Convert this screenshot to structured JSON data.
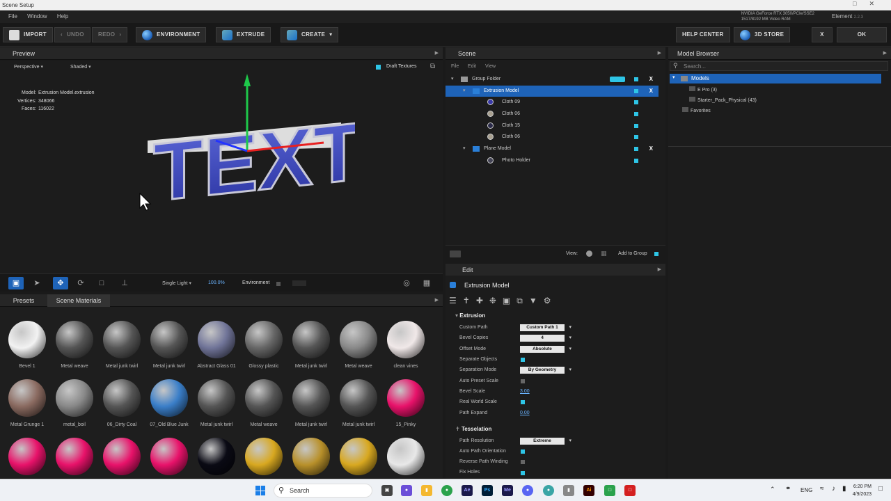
{
  "window": {
    "title": "Scene Setup"
  },
  "menu": [
    "File",
    "Window",
    "Help"
  ],
  "gpu": {
    "name": "NVIDIA GeForce RTX 3050/PCIe/SSE2",
    "vram": "1517/8192 MB Video RAM"
  },
  "element": {
    "name": "Element",
    "version": "2.2.3"
  },
  "toolbar": {
    "import": "IMPORT",
    "undo": "UNDO",
    "redo": "REDO",
    "environment": "ENVIRONMENT",
    "extrude": "EXTRUDE",
    "create": "CREATE",
    "help": "HELP CENTER",
    "store": "3D STORE",
    "close": "X",
    "ok": "OK"
  },
  "preview": {
    "title": "Preview",
    "camera": "Perspective",
    "shading": "Shaded",
    "draft": "Draft Textures",
    "model_label": "Model:",
    "model": "Extrusion Model.extrusion",
    "vertices_label": "Vertices:",
    "vertices": "348066",
    "faces_label": "Faces:",
    "faces": "116022",
    "light": "Single Light",
    "light_pct": "100.0%",
    "environment": "Environment",
    "text3d": "TEXT"
  },
  "scene": {
    "title": "Scene",
    "menu": [
      "File",
      "Edit",
      "View"
    ],
    "tree": [
      {
        "label": "Group Folder",
        "level": 0
      },
      {
        "label": "Extrusion Model",
        "level": 1,
        "selected": true
      },
      {
        "label": "Cloth 09",
        "level": 2,
        "color": "#3a3aa8"
      },
      {
        "label": "Cloth 06",
        "level": 2,
        "color": "#a8a090"
      },
      {
        "label": "Cloth 15",
        "level": 2,
        "color": "#2a2a48"
      },
      {
        "label": "Cloth 06",
        "level": 2,
        "color": "#a8a090"
      },
      {
        "label": "Plane Model",
        "level": 1
      },
      {
        "label": "Photo Holder",
        "level": 2,
        "color": "#445"
      }
    ],
    "view_label": "View:",
    "add_group": "Add to Group"
  },
  "edit": {
    "title": "Edit",
    "object": "Extrusion Model",
    "sec_extrusion": "Extrusion",
    "sec_tess": "Tesselation",
    "custom_path": "Custom Path",
    "custom_path_val": "Custom Path 1",
    "bevel_copies": "Bevel Copies",
    "bevel_copies_val": "4",
    "offset_mode": "Offset Mode",
    "offset_mode_val": "Absolute",
    "separate": "Separate Objects",
    "sep_mode": "Separation Mode",
    "sep_mode_val": "By Geometry",
    "auto_preset": "Auto Preset Scale",
    "bevel_scale": "Bevel Scale",
    "bevel_scale_val": "3.00",
    "real_world": "Real World Scale",
    "path_expand": "Path Expand",
    "path_expand_val": "0.00",
    "path_res": "Path Resolution",
    "path_res_val": "Extreme",
    "auto_orient": "Auto Path Orientation",
    "reverse": "Reverse Path Winding",
    "fix_holes": "Fix Holes"
  },
  "browser": {
    "title": "Model Browser",
    "search_placeholder": "Search...",
    "models": "Models",
    "epro": "E Pro (3)",
    "starter": "Starter_Pack_Physical (43)",
    "favorites": "Favorites"
  },
  "materials": {
    "tab_presets": "Presets",
    "tab_scene": "Scene Materials",
    "items": [
      {
        "name": "Bevel 1",
        "c": "#f2f2f2"
      },
      {
        "name": "Metal weave",
        "c": "#555"
      },
      {
        "name": "Metal junk twirl",
        "c": "#555"
      },
      {
        "name": "Metal junk twirl",
        "c": "#555"
      },
      {
        "name": "Abstract Glass 01",
        "c": "#707498"
      },
      {
        "name": "Glossy plastic",
        "c": "#666"
      },
      {
        "name": "Metal junk twirl",
        "c": "#555"
      },
      {
        "name": "Metal weave",
        "c": "#888"
      },
      {
        "name": "clean vines",
        "c": "#f0e8e8"
      },
      {
        "name": "Metal Grunge 1",
        "c": "#8a6a60"
      },
      {
        "name": "metal_boil",
        "c": "#888"
      },
      {
        "name": "06_Dirty Coal",
        "c": "#555"
      },
      {
        "name": "07_Old Blue Junk",
        "c": "#3a7ec8"
      },
      {
        "name": "Metal junk twirl",
        "c": "#555"
      },
      {
        "name": "Metal weave",
        "c": "#555"
      },
      {
        "name": "Metal junk twirl",
        "c": "#555"
      },
      {
        "name": "Metal junk twirl",
        "c": "#555"
      },
      {
        "name": "15_Pinky",
        "c": "#e8126a"
      },
      {
        "name": "",
        "c": "#e8126a"
      },
      {
        "name": "",
        "c": "#e8126a"
      },
      {
        "name": "",
        "c": "#e8126a"
      },
      {
        "name": "",
        "c": "#e8126a"
      },
      {
        "name": "",
        "c": "#0a0a14"
      },
      {
        "name": "",
        "c": "#d8a820"
      },
      {
        "name": "",
        "c": "#b8902a"
      },
      {
        "name": "",
        "c": "#d8a820"
      },
      {
        "name": "",
        "c": "#e8e8e8"
      }
    ]
  },
  "taskbar": {
    "search": "Search",
    "lang": "ENG",
    "time": "6:20 PM",
    "date": "4/9/2023"
  }
}
